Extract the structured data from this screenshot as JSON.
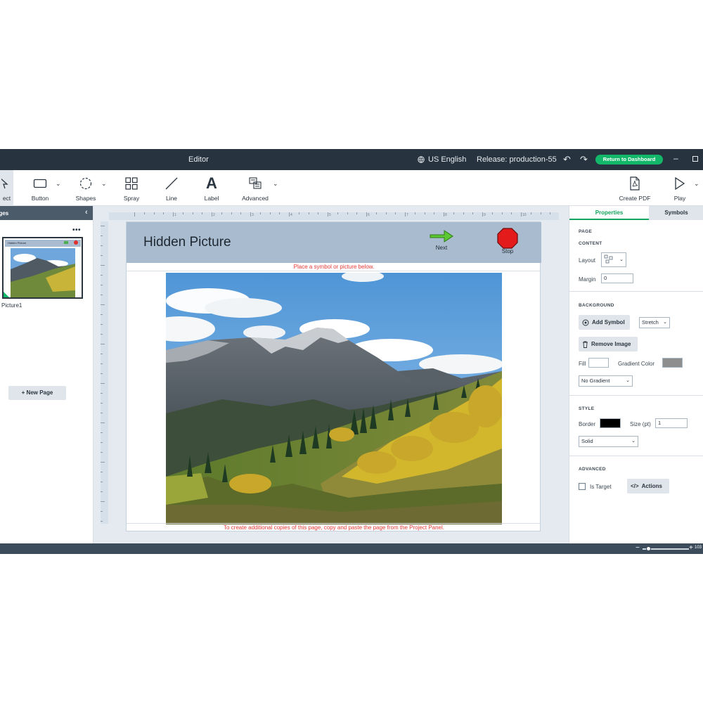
{
  "titlebar": {
    "title": "Editor",
    "language": "US English",
    "release": "Release: production-55",
    "dashboard_button": "Return to Dashboard"
  },
  "toolbar": {
    "select": "ect",
    "button": "Button",
    "shapes": "Shapes",
    "spray": "Spray",
    "line": "Line",
    "label": "Label",
    "advanced": "Advanced",
    "create_pdf": "Create PDF",
    "play": "Play"
  },
  "left_panel": {
    "header": "ages",
    "page_name": "Picture1",
    "thumb_title": "Hidden Picture",
    "new_page": "+ New Page"
  },
  "page": {
    "title": "Hidden Picture",
    "next_label": "Next",
    "stop_label": "Stop",
    "top_hint": "Place a symbol or picture below.",
    "bottom_hint": "To create additional copies of this page, copy and paste the page from the Project Panel."
  },
  "ruler": {
    "numbers": [
      "1",
      "2",
      "3",
      "4",
      "5",
      "6",
      "7",
      "8",
      "9",
      "10"
    ]
  },
  "right_panel": {
    "tabs": {
      "properties": "Properties",
      "symbols": "Symbols"
    },
    "page_heading": "PAGE",
    "content_heading": "CONTENT",
    "layout_label": "Layout",
    "margin_label": "Margin",
    "margin_value": "0",
    "background_heading": "BACKGROUND",
    "add_symbol": "Add Symbol",
    "stretch": "Stretch",
    "remove_image": "Remove Image",
    "fill_label": "Fill",
    "gradient_color_label": "Gradient Color",
    "no_gradient": "No Gradient",
    "style_heading": "STYLE",
    "border_label": "Border",
    "size_label": "Size (pt)",
    "size_value": "1",
    "solid": "Solid",
    "advanced_heading": "ADVANCED",
    "is_target": "Is Target",
    "actions": "Actions"
  },
  "status": {
    "zoom_value": "103",
    "zoom_level": 0.12
  },
  "colors": {
    "titlebar": "#27333e",
    "accent_green": "#12b76a",
    "page_header": "#a9bccf",
    "hint_red": "#e53935",
    "border_swatch": "#000000",
    "gradient_swatch": "#8e8e8e"
  }
}
